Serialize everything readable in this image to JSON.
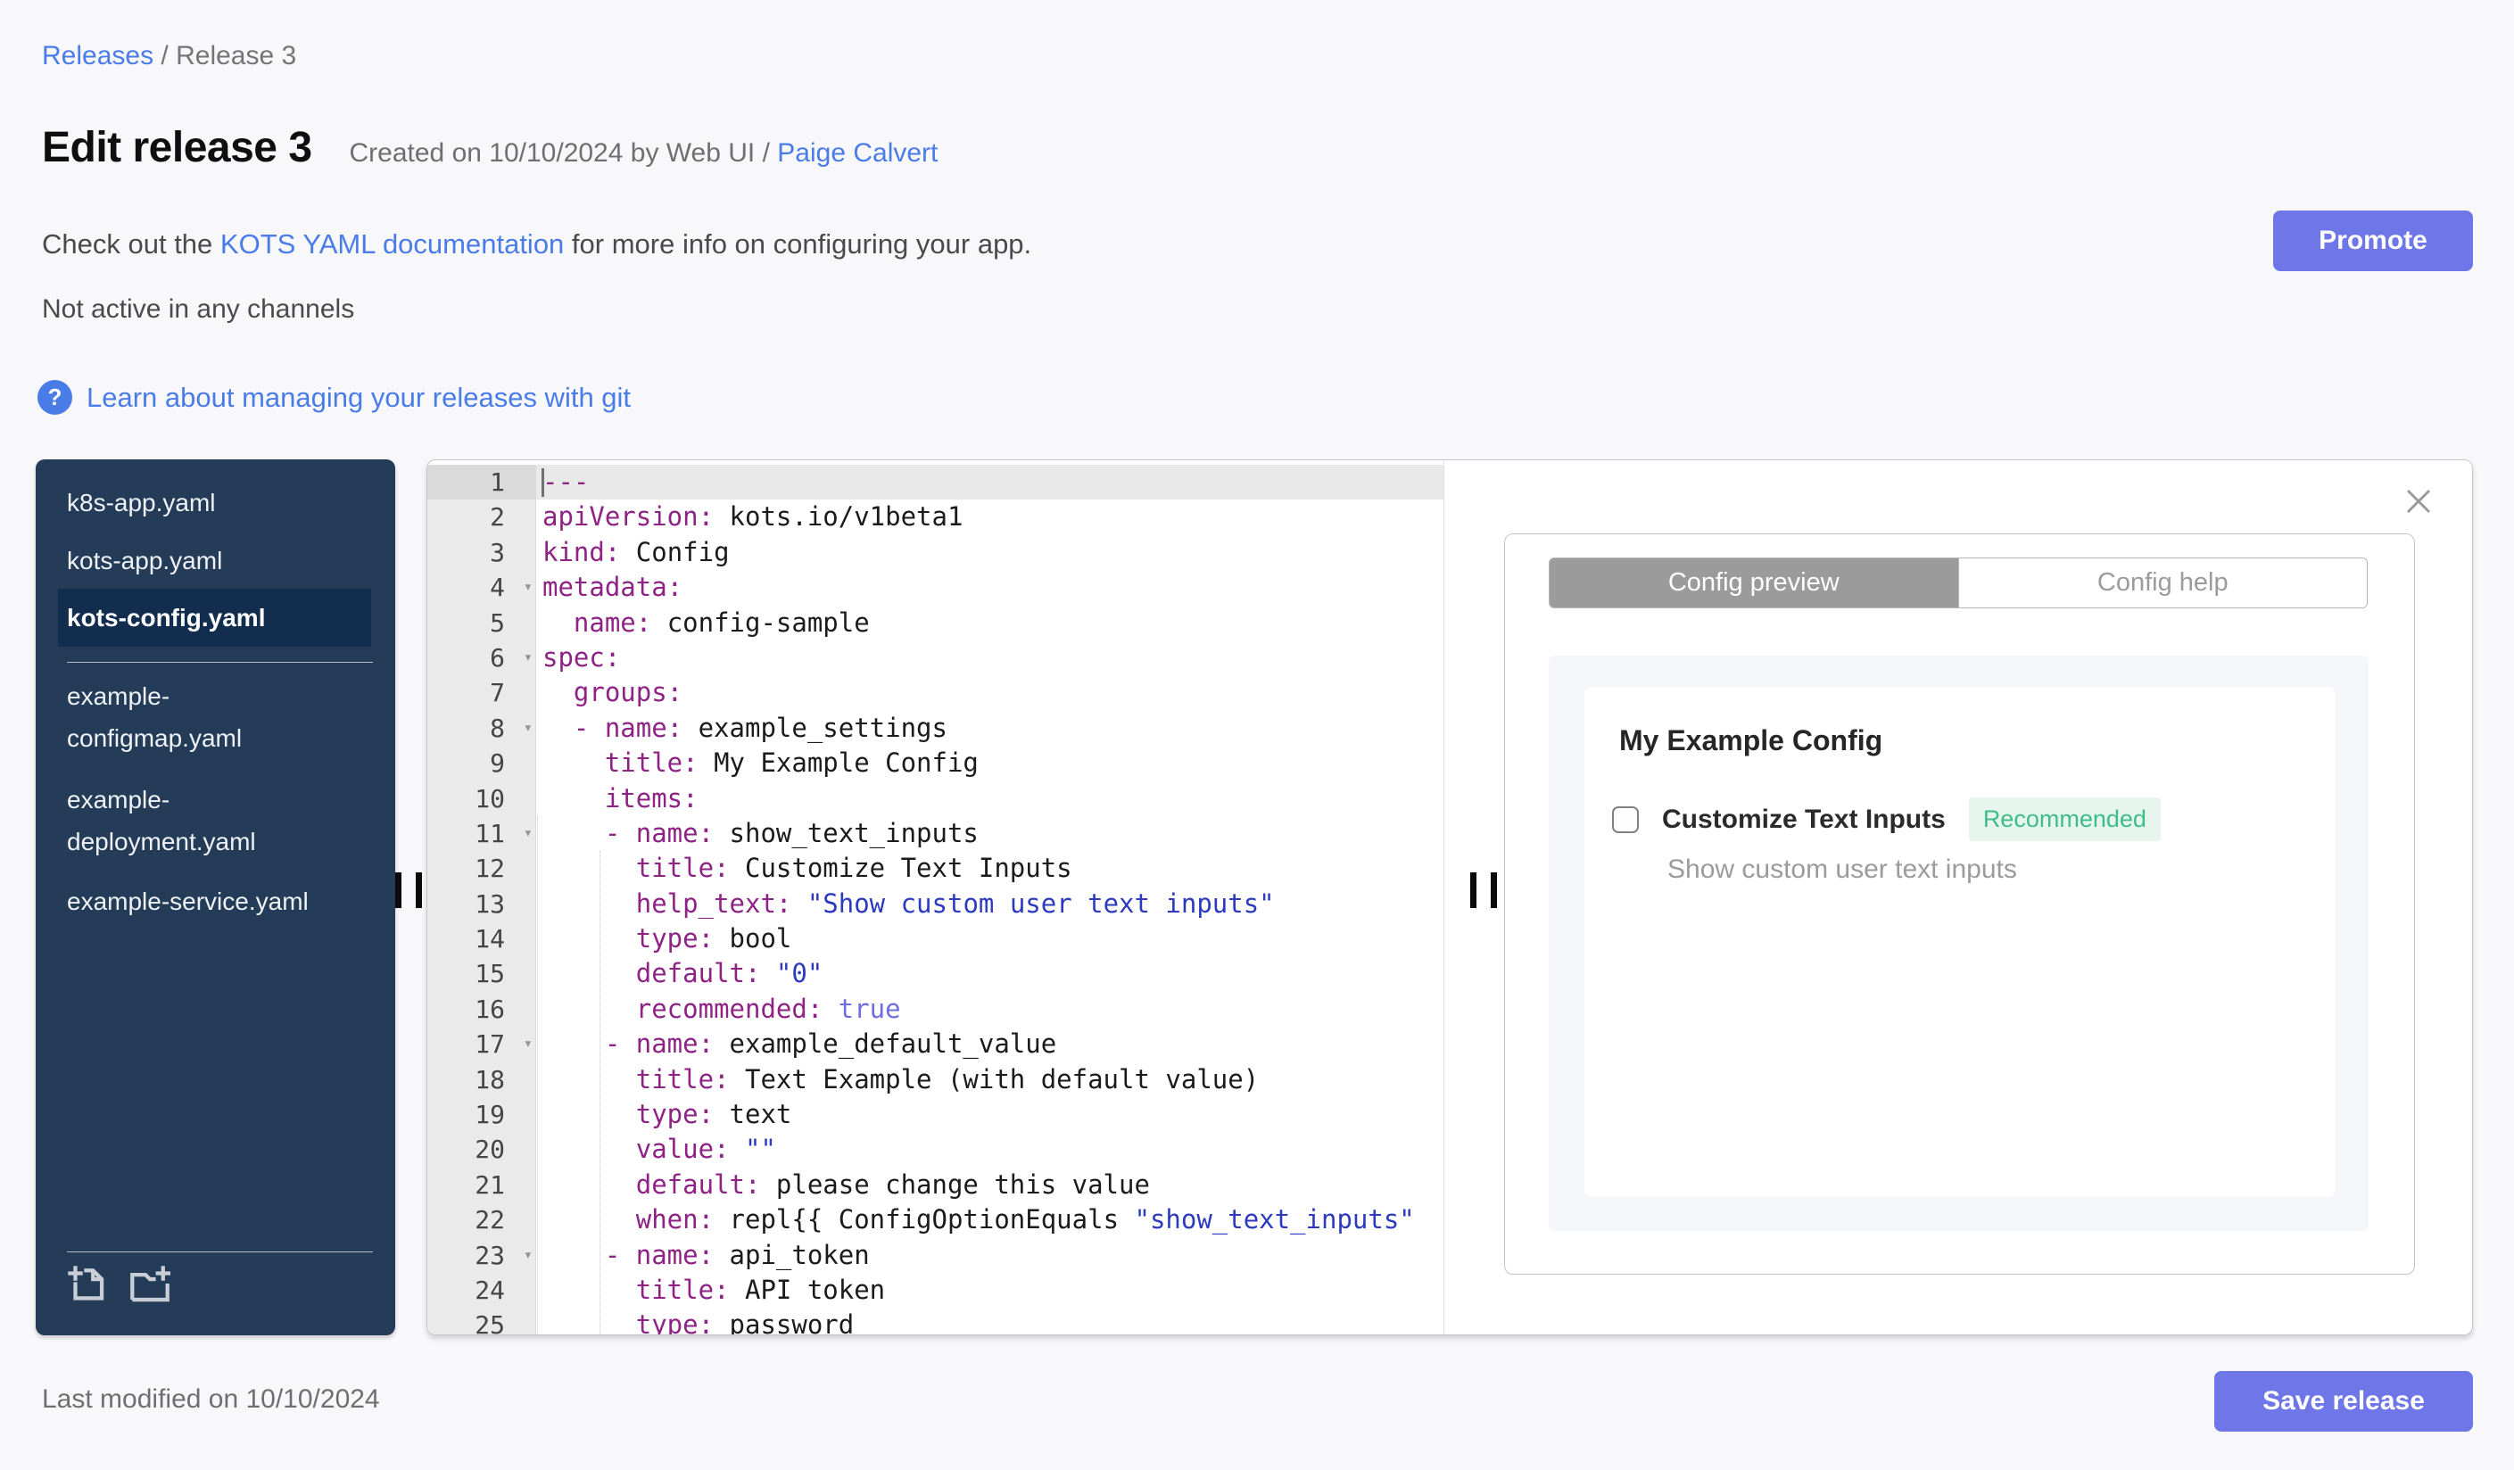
{
  "colors": {
    "accent_blue": "#4a7ce8",
    "button_purple": "#6e76e8",
    "sidebar_navy": "#243c58",
    "badge_green": "#3fbd88"
  },
  "breadcrumb": {
    "releases": "Releases",
    "separator": " / ",
    "current": "Release 3"
  },
  "header": {
    "title": "Edit release 3",
    "created_prefix": "Created on 10/10/2024 by Web UI / ",
    "created_author": "Paige Calvert",
    "docs_prefix": "Check out the ",
    "docs_link": "KOTS YAML documentation",
    "docs_suffix": " for more info on configuring your app.",
    "channel_status": "Not active in any channels",
    "help_icon": "?",
    "git_link": "Learn about managing your releases with git",
    "promote_label": "Promote"
  },
  "sidebar": {
    "files": [
      {
        "lines": [
          "k8s-app.yaml"
        ],
        "selected": false
      },
      {
        "lines": [
          "kots-app.yaml"
        ],
        "selected": false
      },
      {
        "lines": [
          "kots-config.yaml"
        ],
        "selected": true
      },
      {
        "lines": [
          "example-",
          "configmap.yaml"
        ],
        "selected": false
      },
      {
        "lines": [
          "example-",
          "deployment.yaml"
        ],
        "selected": false
      },
      {
        "lines": [
          "example-service.yaml"
        ],
        "selected": false
      }
    ],
    "icons": [
      "new-file-icon",
      "new-folder-icon"
    ]
  },
  "editor": {
    "lines": [
      {
        "n": 1,
        "active": true,
        "fold": false,
        "seg": [
          [
            "---",
            "key"
          ]
        ]
      },
      {
        "n": 2,
        "seg": [
          [
            "apiVersion:",
            "key"
          ],
          [
            " kots.io/v1beta1",
            ""
          ]
        ]
      },
      {
        "n": 3,
        "seg": [
          [
            "kind:",
            "key"
          ],
          [
            " Config",
            ""
          ]
        ]
      },
      {
        "n": 4,
        "fold": true,
        "seg": [
          [
            "metadata:",
            "key"
          ]
        ]
      },
      {
        "n": 5,
        "seg": [
          [
            "  ",
            ""
          ],
          [
            "name:",
            "key"
          ],
          [
            " config-sample",
            ""
          ]
        ]
      },
      {
        "n": 6,
        "fold": true,
        "seg": [
          [
            "spec:",
            "key"
          ]
        ]
      },
      {
        "n": 7,
        "seg": [
          [
            "  ",
            ""
          ],
          [
            "groups:",
            "key"
          ]
        ]
      },
      {
        "n": 8,
        "fold": true,
        "seg": [
          [
            "  ",
            ""
          ],
          [
            "- name:",
            "key"
          ],
          [
            " example_settings",
            ""
          ]
        ]
      },
      {
        "n": 9,
        "seg": [
          [
            "    ",
            ""
          ],
          [
            "title:",
            "key"
          ],
          [
            " My Example Config",
            ""
          ]
        ]
      },
      {
        "n": 10,
        "seg": [
          [
            "    ",
            ""
          ],
          [
            "items:",
            "key"
          ]
        ]
      },
      {
        "n": 11,
        "fold": true,
        "seg": [
          [
            "    ",
            ""
          ],
          [
            "- name:",
            "key"
          ],
          [
            " show_text_inputs",
            ""
          ]
        ]
      },
      {
        "n": 12,
        "seg": [
          [
            "      ",
            ""
          ],
          [
            "title:",
            "key"
          ],
          [
            " Customize Text Inputs",
            ""
          ]
        ]
      },
      {
        "n": 13,
        "seg": [
          [
            "      ",
            ""
          ],
          [
            "help_text:",
            "key"
          ],
          [
            " ",
            ""
          ],
          [
            "\"Show custom user text inputs\"",
            "str"
          ]
        ]
      },
      {
        "n": 14,
        "seg": [
          [
            "      ",
            ""
          ],
          [
            "type:",
            "key"
          ],
          [
            " bool",
            ""
          ]
        ]
      },
      {
        "n": 15,
        "seg": [
          [
            "      ",
            ""
          ],
          [
            "default:",
            "key"
          ],
          [
            " ",
            ""
          ],
          [
            "\"0\"",
            "str"
          ]
        ]
      },
      {
        "n": 16,
        "seg": [
          [
            "      ",
            ""
          ],
          [
            "recommended:",
            "key"
          ],
          [
            " ",
            ""
          ],
          [
            "true",
            "bool"
          ]
        ]
      },
      {
        "n": 17,
        "fold": true,
        "seg": [
          [
            "    ",
            ""
          ],
          [
            "- name:",
            "key"
          ],
          [
            " example_default_value",
            ""
          ]
        ]
      },
      {
        "n": 18,
        "seg": [
          [
            "      ",
            ""
          ],
          [
            "title:",
            "key"
          ],
          [
            " Text Example (with default value)",
            ""
          ]
        ]
      },
      {
        "n": 19,
        "seg": [
          [
            "      ",
            ""
          ],
          [
            "type:",
            "key"
          ],
          [
            " text",
            ""
          ]
        ]
      },
      {
        "n": 20,
        "seg": [
          [
            "      ",
            ""
          ],
          [
            "value:",
            "key"
          ],
          [
            " ",
            ""
          ],
          [
            "\"\"",
            "str"
          ]
        ]
      },
      {
        "n": 21,
        "seg": [
          [
            "      ",
            ""
          ],
          [
            "default:",
            "key"
          ],
          [
            " please change this value",
            ""
          ]
        ]
      },
      {
        "n": 22,
        "seg": [
          [
            "      ",
            ""
          ],
          [
            "when:",
            "key"
          ],
          [
            " repl{{ ConfigOptionEquals ",
            ""
          ],
          [
            "\"show_text_inputs\"",
            "str"
          ]
        ]
      },
      {
        "n": 23,
        "fold": true,
        "seg": [
          [
            "    ",
            ""
          ],
          [
            "- name:",
            "key"
          ],
          [
            " api_token",
            ""
          ]
        ]
      },
      {
        "n": 24,
        "seg": [
          [
            "      ",
            ""
          ],
          [
            "title:",
            "key"
          ],
          [
            " API token",
            ""
          ]
        ]
      },
      {
        "n": 25,
        "seg": [
          [
            "      ",
            ""
          ],
          [
            "type:",
            "key"
          ],
          [
            " password",
            ""
          ]
        ]
      }
    ]
  },
  "preview_panel": {
    "tabs": [
      {
        "label": "Config preview",
        "active": true
      },
      {
        "label": "Config help",
        "active": false
      }
    ],
    "group_title": "My Example Config",
    "item": {
      "label": "Customize Text Inputs",
      "badge": "Recommended",
      "help_text": "Show custom user text inputs",
      "checked": false
    }
  },
  "footer": {
    "last_modified": "Last modified on 10/10/2024",
    "save_label": "Save release"
  }
}
